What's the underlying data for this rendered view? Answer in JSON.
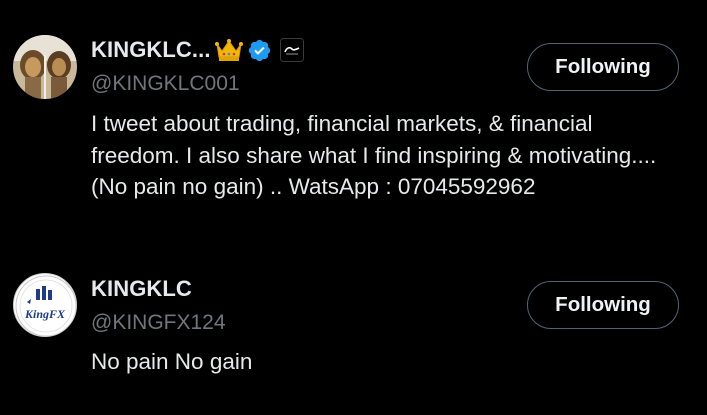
{
  "users": [
    {
      "display_name": "KINGKLC...",
      "handle": "@KINGKLC001",
      "bio": "I tweet about trading, financial markets, & financial freedom. I also share what I find inspiring & motivating.... (No pain no gain) .. WatsApp : 07045592962",
      "follow_label": "Following",
      "badges": [
        "crown-emoji",
        "verified-badge",
        "affiliate-badge"
      ],
      "avatar": "lion-avatar"
    },
    {
      "display_name": "KINGKLC",
      "handle": "@KINGFX124",
      "bio": "No pain No gain",
      "follow_label": "Following",
      "avatar_text": "KingFX"
    }
  ],
  "colors": {
    "background": "#000000",
    "primary_text": "#e7e9ea",
    "secondary_text": "#71767b",
    "verified_blue": "#1d9bf0",
    "button_border": "#536471"
  }
}
